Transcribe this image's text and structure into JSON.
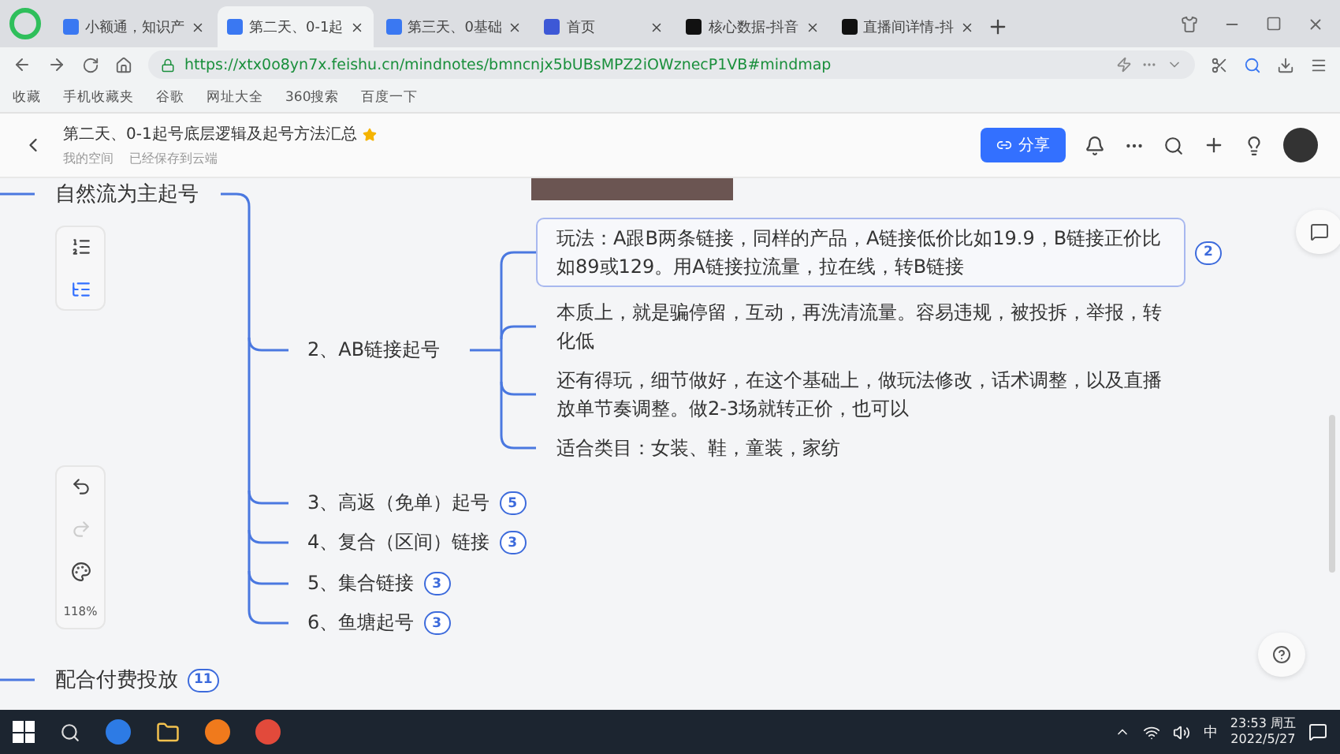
{
  "browser": {
    "tabs": [
      {
        "title": "小额通，知识产",
        "selected": false
      },
      {
        "title": "第二天、0-1起",
        "selected": true
      },
      {
        "title": "第三天、0基础",
        "selected": false
      },
      {
        "title": "首页",
        "selected": false
      },
      {
        "title": "核心数据-抖音",
        "selected": false
      },
      {
        "title": "直播间详情-抖",
        "selected": false
      }
    ],
    "url": "https://xtx0o8yn7x.feishu.cn/mindnotes/bmncnjx5bUBsMPZ2iOWznecP1VB#mindmap",
    "bookmarks": [
      "收藏",
      "手机收藏夹",
      "谷歌",
      "网址大全",
      "360搜索",
      "百度一下"
    ]
  },
  "document": {
    "title": "第二天、0-1起号底层逻辑及起号方法汇总",
    "location": "我的空间",
    "save_status": "已经保存到云端",
    "share_label": "分享"
  },
  "mindmap": {
    "branches": [
      {
        "text": "自然流为主起号",
        "children": [
          {
            "text": "2、AB链接起号",
            "children": [
              {
                "text": "玩法：A跟B两条链接，同样的产品，A链接低价比如19.9，B链接正价比如89或129。用A链接拉流量，拉在线，转B链接",
                "badge": "2",
                "selected": true
              },
              {
                "text": "本质上，就是骗停留，互动，再洗清流量。容易违规，被投拆，举报，转化低",
                "selected": false
              },
              {
                "text": "还有得玩，细节做好，在这个基础上，做玩法修改，话术调整，以及直播放单节奏调整。做2-3场就转正价，也可以",
                "selected": false
              },
              {
                "text": "适合类目：女装、鞋，童装，家纺",
                "selected": false
              }
            ]
          },
          {
            "text": "3、高返（免单）起号",
            "badge": "5"
          },
          {
            "text": "4、复合（区间）链接",
            "badge": "3"
          },
          {
            "text": "5、集合链接",
            "badge": "3"
          },
          {
            "text": "6、鱼塘起号",
            "badge": "3"
          }
        ]
      },
      {
        "text": "配合付费投放",
        "badge": "11"
      }
    ]
  },
  "controls": {
    "zoom": "118%",
    "redo_enabled": false
  },
  "taskbar": {
    "ime": "中",
    "time": "23:53 周五",
    "date": "2022/5/27"
  }
}
